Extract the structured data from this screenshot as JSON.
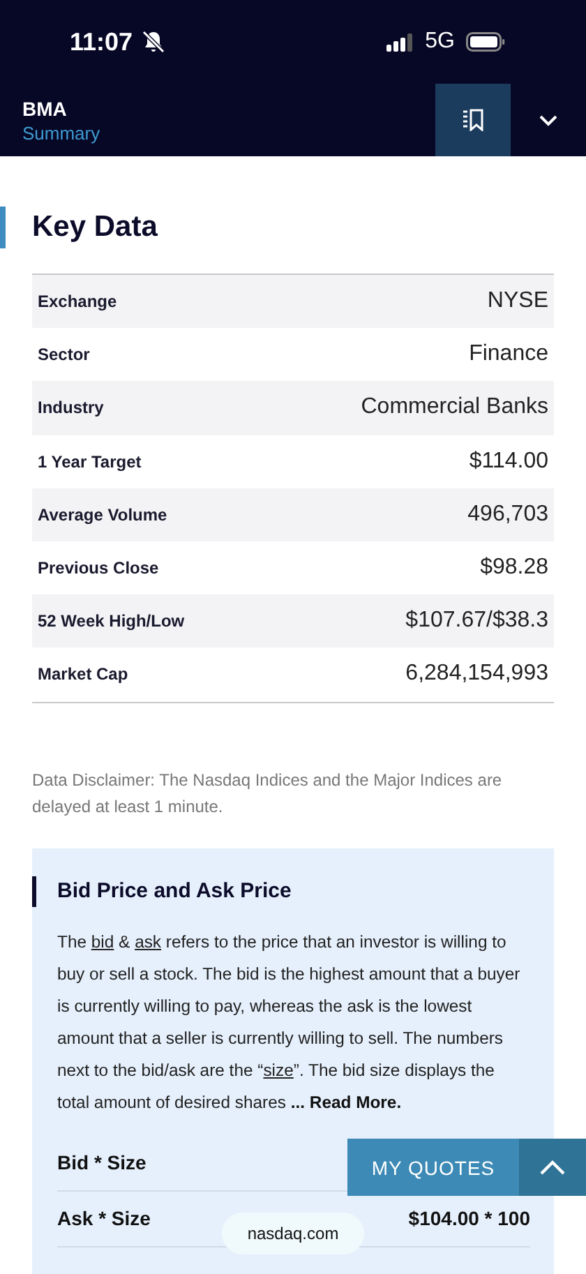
{
  "status_bar": {
    "time": "11:07",
    "network": "5G"
  },
  "header": {
    "symbol": "BMA",
    "subtitle": "Summary"
  },
  "key_data": {
    "title": "Key Data",
    "rows": [
      {
        "label": "Exchange",
        "value": "NYSE"
      },
      {
        "label": "Sector",
        "value": "Finance"
      },
      {
        "label": "Industry",
        "value": "Commercial Banks"
      },
      {
        "label": "1 Year Target",
        "value": "$114.00"
      },
      {
        "label": "Average Volume",
        "value": "496,703"
      },
      {
        "label": "Previous Close",
        "value": "$98.28"
      },
      {
        "label": "52 Week High/Low",
        "value": "$107.67/$38.3"
      },
      {
        "label": "Market Cap",
        "value": "6,284,154,993"
      }
    ]
  },
  "disclaimer": "Data Disclaimer: The Nasdaq Indices and the Major Indices are delayed at least 1 minute.",
  "bid_ask": {
    "title": "Bid Price and Ask Price",
    "paragraph": [
      {
        "kind": "text",
        "text": "The "
      },
      {
        "kind": "link",
        "text": "bid"
      },
      {
        "kind": "text",
        "text": " & "
      },
      {
        "kind": "link",
        "text": "ask"
      },
      {
        "kind": "text",
        "text": " refers to the price that an investor is willing to buy or sell a stock. The bid is the highest amount that a buyer is currently willing to pay, whereas the ask is the lowest amount that a seller is currently willing to sell. The numbers next to the bid/ask are the “"
      },
      {
        "kind": "link",
        "text": "size"
      },
      {
        "kind": "text",
        "text": "”. The bid size displays the total amount of desired shares "
      },
      {
        "kind": "more",
        "text": "... Read More."
      }
    ],
    "rows": [
      {
        "label": "Bid * Size"
      },
      {
        "label": "Ask * Size",
        "value": "$104.00 * 100"
      }
    ]
  },
  "my_quotes": {
    "label": "MY QUOTES"
  },
  "url_pill": "nasdaq.com"
}
